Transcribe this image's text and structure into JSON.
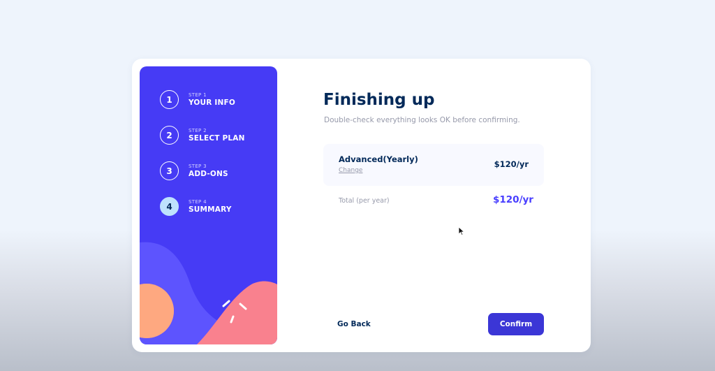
{
  "sidebar": {
    "steps": [
      {
        "number": "1",
        "label": "STEP 1",
        "title": "YOUR INFO"
      },
      {
        "number": "2",
        "label": "STEP 2",
        "title": "SELECT PLAN"
      },
      {
        "number": "3",
        "label": "STEP 3",
        "title": "ADD-ONS"
      },
      {
        "number": "4",
        "label": "STEP 4",
        "title": "SUMMARY",
        "active": true
      }
    ]
  },
  "main": {
    "title": "Finishing up",
    "subtitle": "Double-check everything looks OK before confirming.",
    "summary": {
      "plan_name": "Advanced(Yearly)",
      "change_label": "Change",
      "plan_price": "$120/yr"
    },
    "total": {
      "label": "Total (per year)",
      "price": "$120/yr"
    }
  },
  "footer": {
    "back_label": "Go Back",
    "confirm_label": "Confirm"
  },
  "colors": {
    "sidebar_bg": "#463bf5",
    "accent": "#483eff",
    "confirm_bg": "#3b36d6",
    "text_primary": "#022959",
    "text_muted": "#9699aa",
    "active_step_bg": "#bee2fd"
  },
  "icons": [
    "mouse-pointer-icon"
  ]
}
